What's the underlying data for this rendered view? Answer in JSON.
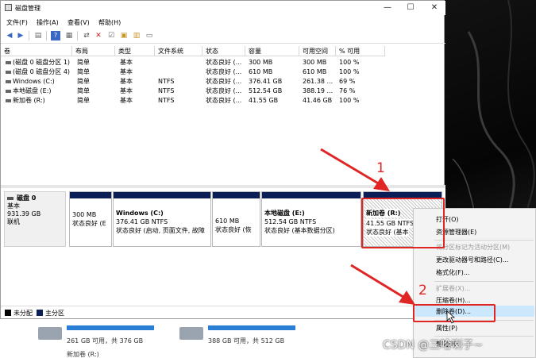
{
  "window": {
    "title": "磁盘管理",
    "min_label": "—",
    "max_label": "☐",
    "close_label": "✕"
  },
  "menu": [
    "文件(F)",
    "操作(A)",
    "查看(V)",
    "帮助(H)"
  ],
  "toolbar_icons": [
    "back-icon",
    "forward-icon",
    "console-tree-icon",
    "help-icon",
    "properties-icon",
    "connect-icon",
    "delete-icon",
    "check-icon",
    "open-folder-icon",
    "view-icon"
  ],
  "table": {
    "headers": [
      "卷",
      "布局",
      "类型",
      "文件系统",
      "状态",
      "容量",
      "可用空间",
      "% 可用"
    ],
    "rows": [
      [
        "(磁盘 0 磁盘分区 1)",
        "简单",
        "基本",
        "",
        "状态良好 (...",
        "300 MB",
        "300 MB",
        "100 %"
      ],
      [
        "(磁盘 0 磁盘分区 4)",
        "简单",
        "基本",
        "",
        "状态良好 (...",
        "610 MB",
        "610 MB",
        "100 %"
      ],
      [
        "Windows (C:)",
        "简单",
        "基本",
        "NTFS",
        "状态良好 (...",
        "376.41 GB",
        "261.38 ...",
        "69 %"
      ],
      [
        "本地磁盘 (E:)",
        "简单",
        "基本",
        "NTFS",
        "状态良好 (...",
        "512.54 GB",
        "388.19 ...",
        "76 %"
      ],
      [
        "新加卷 (R:)",
        "简单",
        "基本",
        "NTFS",
        "状态良好 (...",
        "41.55 GB",
        "41.46 GB",
        "100 %"
      ]
    ]
  },
  "disk": {
    "name": "磁盘 0",
    "type": "基本",
    "size": "931.39 GB",
    "status": "联机"
  },
  "partitions": [
    {
      "title": "",
      "size": "300 MB",
      "status": "状态良好 (E"
    },
    {
      "title": "Windows (C:)",
      "size": "376.41 GB NTFS",
      "status": "状态良好 (启动, 页面文件, 故障"
    },
    {
      "title": "",
      "size": "610 MB",
      "status": "状态良好 (恢"
    },
    {
      "title": "本地磁盘 (E:)",
      "size": "512.54 GB NTFS",
      "status": "状态良好 (基本数据分区)"
    },
    {
      "title": "新加卷 (R:)",
      "size": "41.55 GB NTFS",
      "status": "状态良好 (基本"
    }
  ],
  "legend": {
    "unallocated": "未分配",
    "primary": "主分区"
  },
  "explorer": {
    "drive1_free": "261 GB 可用，共 376 GB",
    "drive2_free": "388 GB 可用，共 512 GB",
    "drive3_name": "新加卷 (R:)"
  },
  "context_menu": {
    "items": [
      {
        "label": "打开(O)",
        "enabled": true
      },
      {
        "label": "资源管理器(E)",
        "enabled": true
      },
      {
        "label": "将分区标记为活动分区(M)",
        "enabled": false
      },
      {
        "label": "更改驱动器号和路径(C)...",
        "enabled": true
      },
      {
        "label": "格式化(F)...",
        "enabled": true
      },
      {
        "label": "扩展卷(X)...",
        "enabled": false
      },
      {
        "label": "压缩卷(H)...",
        "enabled": true
      },
      {
        "label": "删除卷(D)...",
        "enabled": true
      },
      {
        "label": "属性(P)",
        "enabled": true
      },
      {
        "label": "帮助(H)",
        "enabled": true
      }
    ]
  },
  "annotations": {
    "step1": "1",
    "step2": "2"
  },
  "watermark": "CSDN @三哈喇子~",
  "colors": {
    "partition_header": "#0a1e58",
    "highlight": "#cce8ff",
    "annotation_red": "#e02525"
  }
}
